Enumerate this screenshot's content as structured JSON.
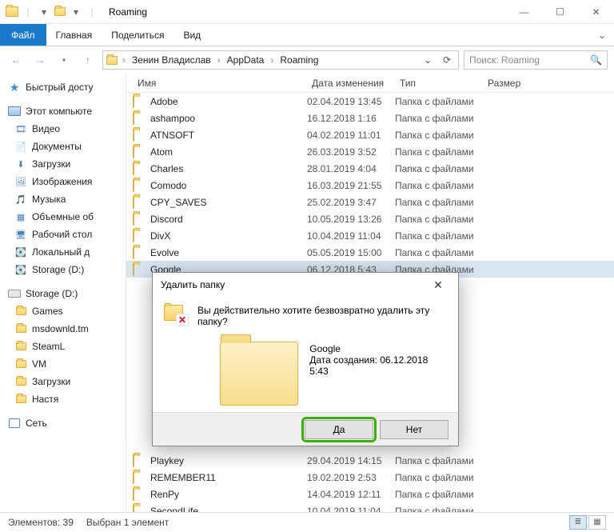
{
  "window": {
    "title": "Roaming"
  },
  "ribbon": {
    "file": "Файл",
    "tabs": [
      "Главная",
      "Поделиться",
      "Вид"
    ]
  },
  "breadcrumb": {
    "items": [
      "Зенин Владислав",
      "AppData",
      "Roaming"
    ]
  },
  "search": {
    "placeholder": "Поиск: Roaming"
  },
  "columns": {
    "name": "Имя",
    "date": "Дата изменения",
    "type": "Тип",
    "size": "Размер"
  },
  "sidebar": {
    "quick": "Быстрый досту",
    "thispc": "Этот компьюте",
    "thispc_items": [
      "Видео",
      "Документы",
      "Загрузки",
      "Изображения",
      "Музыка",
      "Объемные об",
      "Рабочий стол",
      "Локальный д",
      "Storage (D:)"
    ],
    "storage_header": "Storage (D:)",
    "storage_items": [
      "Games",
      "msdownld.tm",
      "SteamL",
      "VM",
      "Загрузки",
      "Настя"
    ],
    "network": "Сеть"
  },
  "files": [
    {
      "name": "Adobe",
      "date": "02.04.2019 13:45",
      "type": "Папка с файлами"
    },
    {
      "name": "ashampoo",
      "date": "16.12.2018 1:16",
      "type": "Папка с файлами"
    },
    {
      "name": "ATNSOFT",
      "date": "04.02.2019 11:01",
      "type": "Папка с файлами"
    },
    {
      "name": "Atom",
      "date": "26.03.2019 3:52",
      "type": "Папка с файлами"
    },
    {
      "name": "Charles",
      "date": "28.01.2019 4:04",
      "type": "Папка с файлами"
    },
    {
      "name": "Comodo",
      "date": "16.03.2019 21:55",
      "type": "Папка с файлами"
    },
    {
      "name": "CPY_SAVES",
      "date": "25.02.2019 3:47",
      "type": "Папка с файлами"
    },
    {
      "name": "Discord",
      "date": "10.05.2019 13:26",
      "type": "Папка с файлами"
    },
    {
      "name": "DivX",
      "date": "10.04.2019 11:04",
      "type": "Папка с файлами"
    },
    {
      "name": "Evolve",
      "date": "05.05.2019 15:00",
      "type": "Папка с файлами"
    },
    {
      "name": "Google",
      "date": "06.12.2018 5:43",
      "type": "Папка с файлами",
      "selected": true
    },
    {
      "name": "Playkey",
      "date": "29.04.2019 14:15",
      "type": "Папка с файлами"
    },
    {
      "name": "REMEMBER11",
      "date": "19.02.2019 2:53",
      "type": "Папка с файлами"
    },
    {
      "name": "RenPy",
      "date": "14.04.2019 12:11",
      "type": "Папка с файлами"
    },
    {
      "name": "SecondLife",
      "date": "10.04.2019 11:04",
      "type": "Папка с файлами"
    }
  ],
  "dialog": {
    "title": "Удалить папку",
    "message": "Вы действительно хотите безвозвратно удалить эту папку?",
    "item_name": "Google",
    "created_label": "Дата создания: 06.12.2018 5:43",
    "yes": "Да",
    "no": "Нет"
  },
  "status": {
    "count": "Элементов: 39",
    "selected": "Выбран 1 элемент"
  }
}
